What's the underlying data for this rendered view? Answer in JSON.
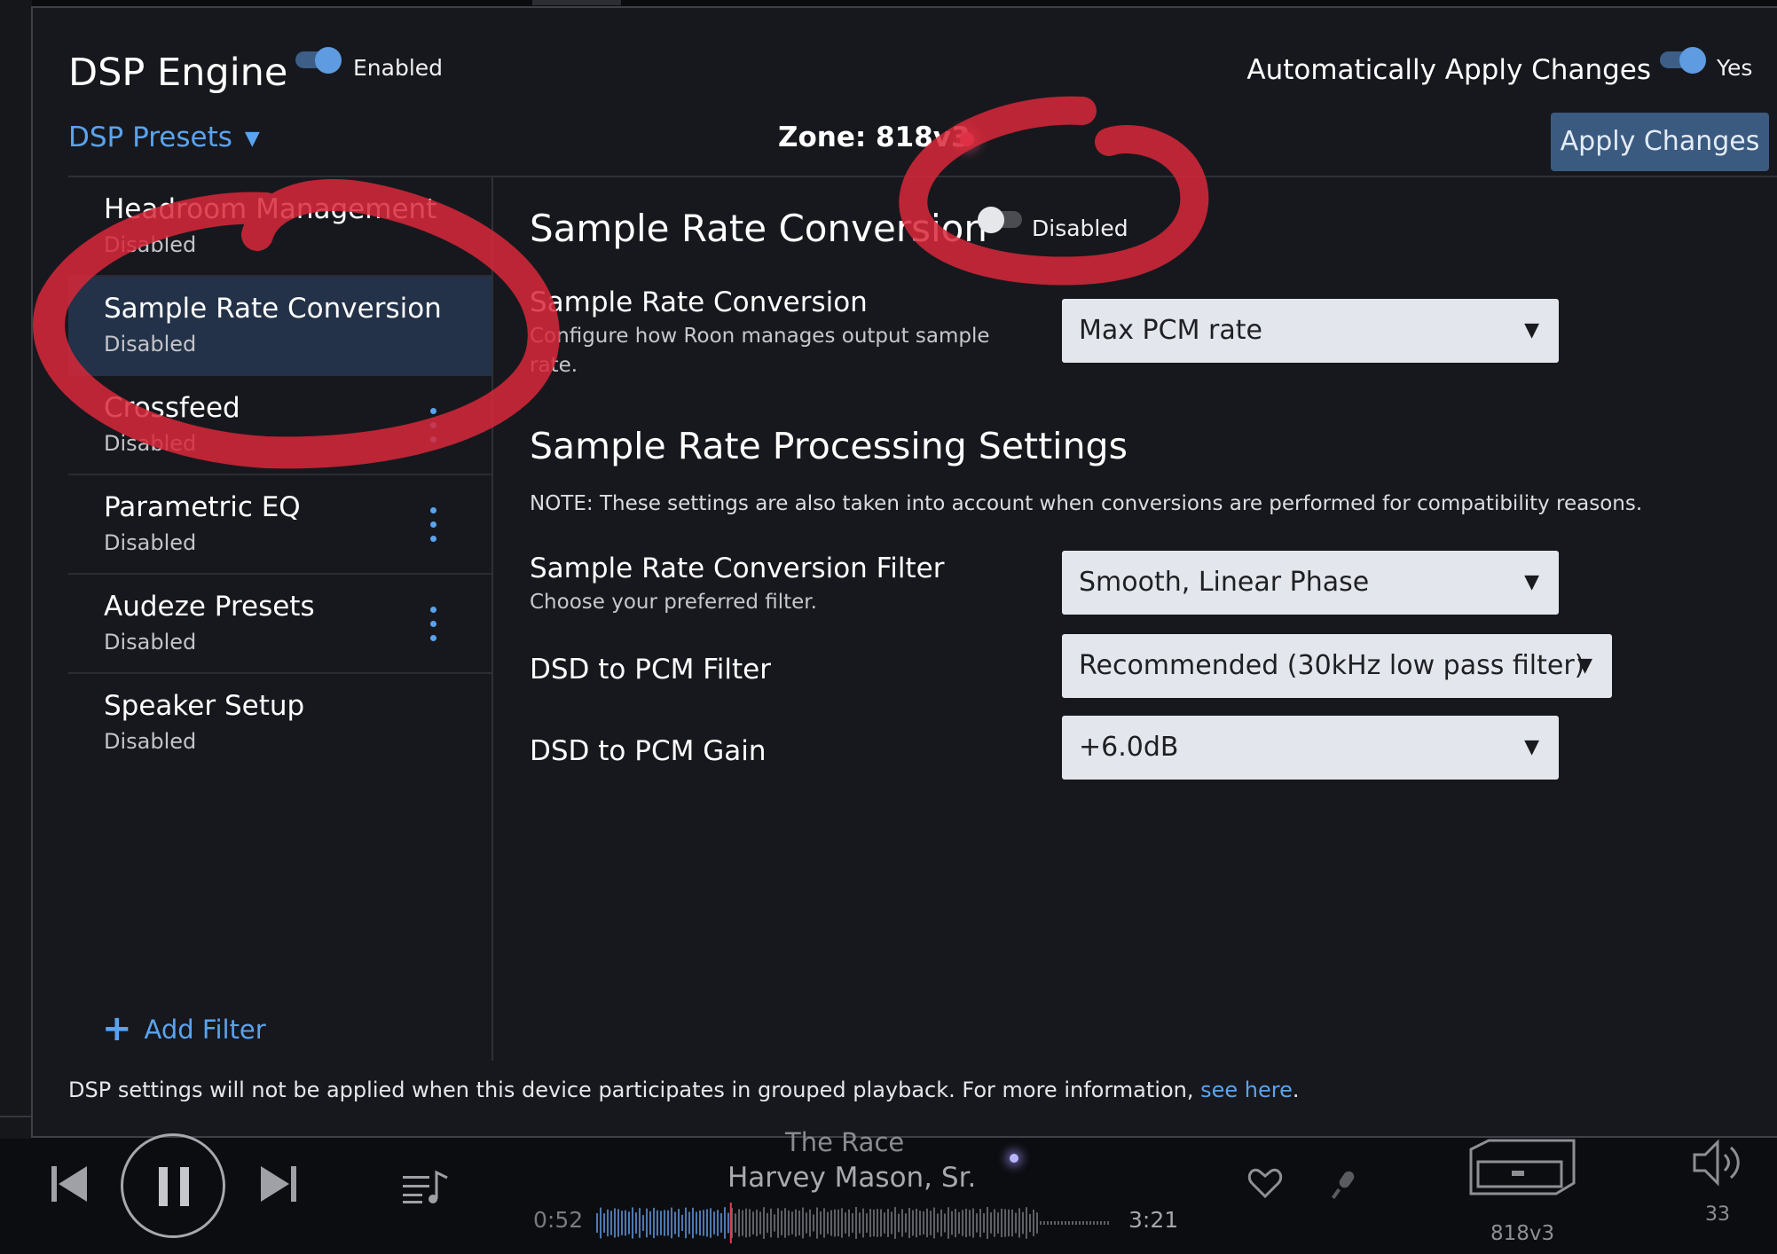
{
  "dsp_engine": {
    "title": "DSP Engine",
    "enabled_label": "Enabled",
    "auto_apply_label": "Automatically Apply Changes",
    "auto_apply_value": "Yes",
    "presets_label": "DSP Presets",
    "zone_label": "Zone: 818v3",
    "apply_button": "Apply Changes"
  },
  "filters": [
    {
      "name": "Headroom Management",
      "status": "Disabled"
    },
    {
      "name": "Sample Rate Conversion",
      "status": "Disabled"
    },
    {
      "name": "Crossfeed",
      "status": "Disabled"
    },
    {
      "name": "Parametric EQ",
      "status": "Disabled"
    },
    {
      "name": "Audeze Presets",
      "status": "Disabled"
    },
    {
      "name": "Speaker Setup",
      "status": "Disabled"
    }
  ],
  "add_filter": "Add Filter",
  "detail": {
    "title": "Sample Rate Conversion",
    "toggle_label": "Disabled",
    "src_label": "Sample Rate Conversion",
    "src_desc": "Configure how Roon manages output sample rate.",
    "src_value": "Max PCM rate",
    "processing_title": "Sample Rate Processing Settings",
    "note": "NOTE: These settings are also taken into account when conversions are performed for compatibility reasons.",
    "filter_label": "Sample Rate Conversion Filter",
    "filter_desc": "Choose your preferred filter.",
    "filter_value": "Smooth, Linear Phase",
    "dsd_filter_label": "DSD to PCM Filter",
    "dsd_filter_value": "Recommended (30kHz low pass filter)",
    "dsd_gain_label": "DSD to PCM Gain",
    "dsd_gain_value": "+6.0dB"
  },
  "footer": {
    "note": "DSP settings will not be applied when this device participates in grouped playback. For more information, ",
    "link": "see here",
    "period": "."
  },
  "player": {
    "track_title": "The Race",
    "artist": "Harvey Mason, Sr.",
    "elapsed": "0:52",
    "total": "3:21",
    "progress_fraction": 0.26,
    "zone": "818v3",
    "volume": "33"
  },
  "colors": {
    "accent": "#5aa3ee",
    "annotation": "#d8283a",
    "selected_row": "#233248"
  }
}
